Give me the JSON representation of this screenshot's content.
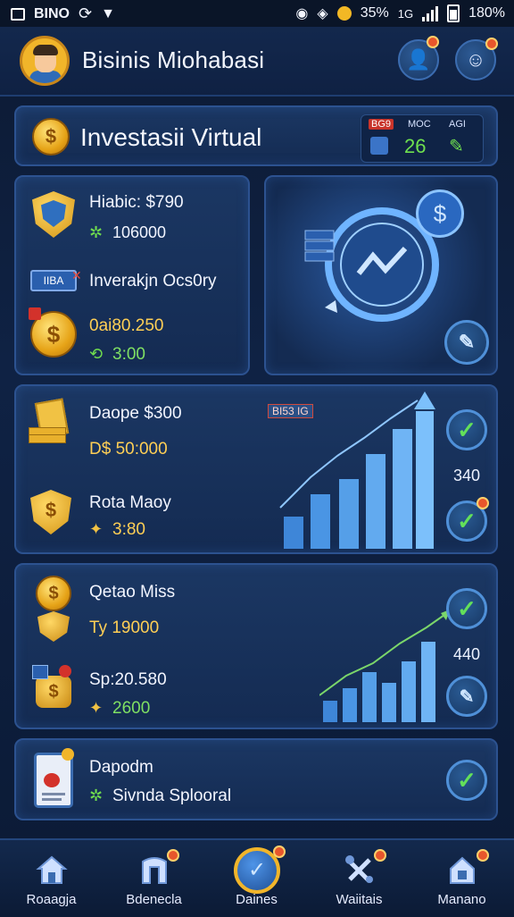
{
  "status_bar": {
    "carrier": "BINO",
    "battery_left": "35%",
    "network": "1G",
    "battery": "180%"
  },
  "header": {
    "title": "Bisinis Miohabasi"
  },
  "hero": {
    "title": "Investasii Virtual",
    "panel_label_1": "BG9",
    "panel_label_2": "MOC",
    "panel_label_3": "AGI",
    "panel_value": "26"
  },
  "card1": {
    "line1": "Hiabic: $790",
    "line2": "106000",
    "line3": "Inverakjn Ocs0ry",
    "line3_badge": "IIBA",
    "line4": "0ai80.250",
    "line5": "3:00"
  },
  "card2": {
    "line1": "Daope $300",
    "line2": "D$ 50:000",
    "chart_label": "BI53 IG",
    "line3": "Rota Maoy",
    "line4": "3:80",
    "side_value": "340"
  },
  "card3": {
    "line1": "Qetao Miss",
    "line2": "Ty 19000",
    "line3": "Sp:20.580",
    "line4": "2600",
    "side_value": "440"
  },
  "card4": {
    "line1": "Dapodm",
    "line2": "Sivnda Splooral"
  },
  "bottom_nav": [
    {
      "label": "Roaagja",
      "icon": "home-icon"
    },
    {
      "label": "Bdenecla",
      "icon": "building-icon"
    },
    {
      "label": "Daines",
      "icon": "checkmark-icon"
    },
    {
      "label": "Waiitais",
      "icon": "tools-icon"
    },
    {
      "label": "Manano",
      "icon": "lock-icon"
    }
  ]
}
